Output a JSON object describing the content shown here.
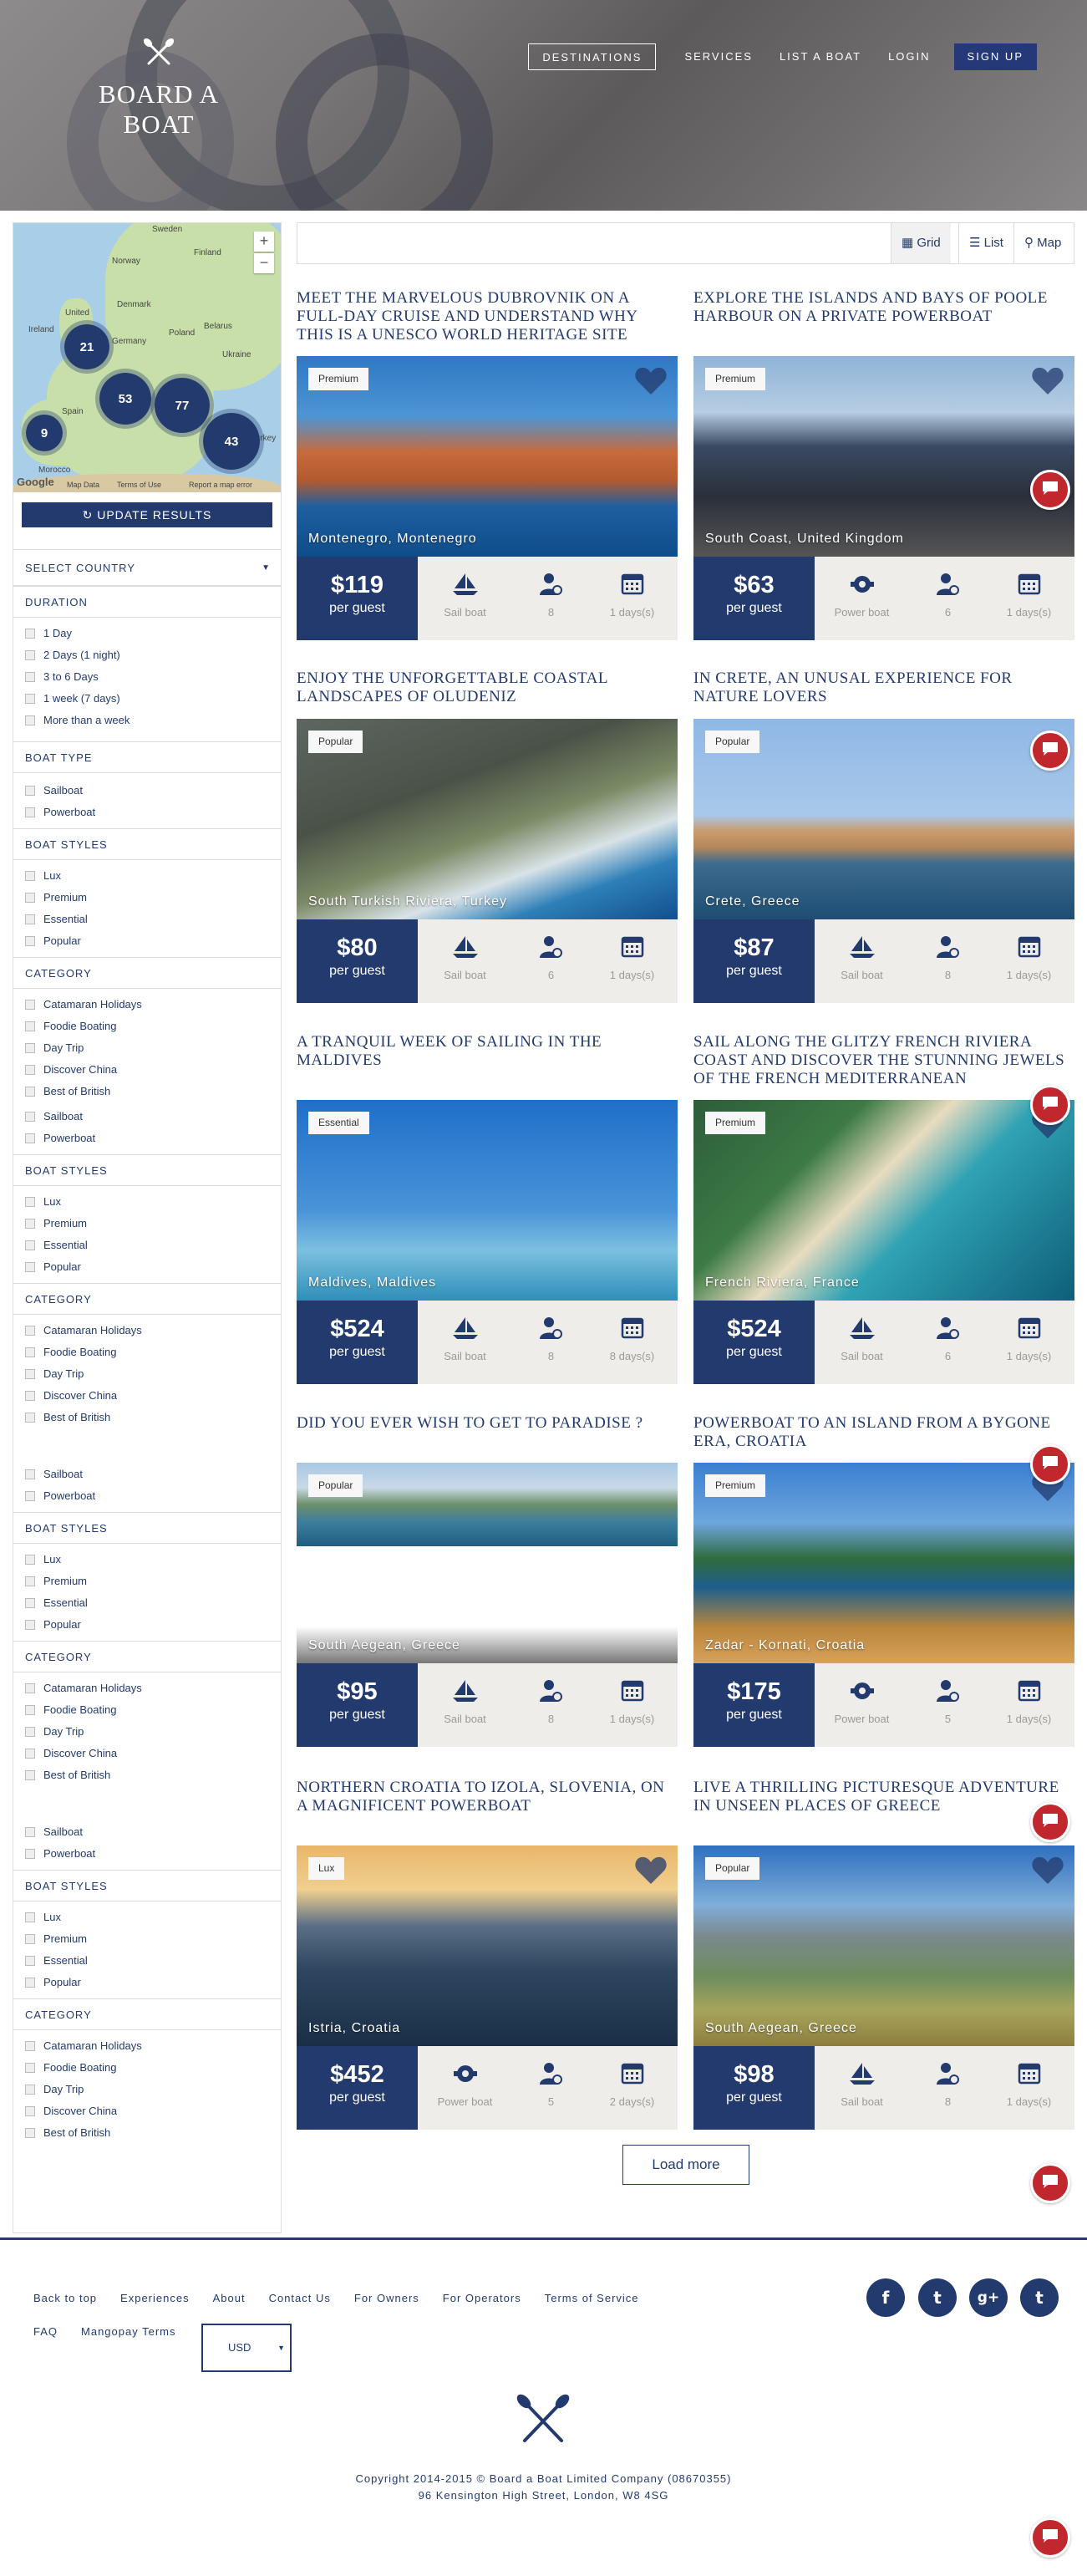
{
  "header": {
    "brand": "BOARD A BOAT",
    "nav": {
      "destinations": "DESTINATIONS",
      "services": "SERVICES",
      "list_boat": "LIST A BOAT",
      "login": "LOGIN",
      "signup": "SIGN UP"
    }
  },
  "map": {
    "clusters": [
      "21",
      "53",
      "77",
      "9",
      "43"
    ],
    "labels": {
      "sweden": "Sweden",
      "finland": "Finland",
      "norway": "Norway",
      "ireland": "Ireland",
      "united": "United",
      "denmark": "Denmark",
      "germany": "Germany",
      "poland": "Poland",
      "belarus": "Belarus",
      "ukraine": "Ukraine",
      "spain": "Spain",
      "turkey": "Turkey",
      "morocco": "Morocco"
    },
    "attribution": {
      "google": "Google",
      "data": "Map Data",
      "terms": "Terms of Use",
      "report": "Report a map error"
    },
    "zoom_in": "+",
    "zoom_out": "−"
  },
  "sidebar": {
    "update_label": "UPDATE RESULTS",
    "select_country": "SELECT COUNTRY",
    "duration_head": "DURATION",
    "durations": [
      "1 Day",
      "2 Days (1 night)",
      "3 to 6 Days",
      "1 week (7 days)",
      "More than a week"
    ],
    "boat_type_head": "BOAT TYPE",
    "boat_types": [
      "Sailboat",
      "Powerboat"
    ],
    "boat_styles_head": "BOAT STYLES",
    "boat_styles": [
      "Lux",
      "Premium",
      "Essential",
      "Popular"
    ],
    "category_head": "CATEGORY",
    "categories": [
      "Catamaran Holidays",
      "Foodie Boating",
      "Day Trip",
      "Discover China",
      "Best of British"
    ]
  },
  "toolbar": {
    "grid": "Grid",
    "list": "List",
    "map": "Map"
  },
  "listings": [
    {
      "title": "MEET THE MARVELOUS DUBROVNIK ON A FULL-DAY CRUISE AND UNDERSTAND WHY THIS IS A UNESCO WORLD HERITAGE SITE",
      "badge": "Premium",
      "location": "Montenegro, Montenegro",
      "price": "$119",
      "per": "per guest",
      "boat": "Sail boat",
      "guests": "8",
      "days": "1 days(s)"
    },
    {
      "title": "EXPLORE THE ISLANDS AND BAYS OF POOLE HARBOUR ON A PRIVATE POWERBOAT",
      "badge": "Premium",
      "location": "South Coast, United Kingdom",
      "price": "$63",
      "per": "per guest",
      "boat": "Power boat",
      "guests": "6",
      "days": "1 days(s)"
    },
    {
      "title": "ENJOY THE UNFORGETTABLE COASTAL LANDSCAPES OF OLUDENIZ",
      "badge": "Popular",
      "location": "South Turkish Riviera, Turkey",
      "price": "$80",
      "per": "per guest",
      "boat": "Sail boat",
      "guests": "6",
      "days": "1 days(s)"
    },
    {
      "title": "IN CRETE, AN UNUSAL EXPERIENCE FOR NATURE LOVERS",
      "badge": "Popular",
      "location": "Crete, Greece",
      "price": "$87",
      "per": "per guest",
      "boat": "Sail boat",
      "guests": "8",
      "days": "1 days(s)"
    },
    {
      "title": "A TRANQUIL WEEK OF SAILING IN THE MALDIVES",
      "badge": "Essential",
      "location": "Maldives, Maldives",
      "price": "$524",
      "per": "per guest",
      "boat": "Sail boat",
      "guests": "8",
      "days": "8 days(s)"
    },
    {
      "title": "SAIL ALONG THE GLITZY FRENCH RIVIERA COAST AND DISCOVER THE STUNNING JEWELS OF THE FRENCH MEDITERRANEAN",
      "badge": "Premium",
      "location": "French Riviera, France",
      "price": "$524",
      "per": "per guest",
      "boat": "Sail boat",
      "guests": "6",
      "days": "1 days(s)"
    },
    {
      "title": "DID YOU EVER WISH TO GET TO PARADISE ?",
      "badge": "Popular",
      "location": "South Aegean, Greece",
      "price": "$95",
      "per": "per guest",
      "boat": "Sail boat",
      "guests": "8",
      "days": "1 days(s)"
    },
    {
      "title": "POWERBOAT TO AN ISLAND FROM A BYGONE ERA, CROATIA",
      "badge": "Premium",
      "location": "Zadar - Kornati, Croatia",
      "price": "$175",
      "per": "per guest",
      "boat": "Power boat",
      "guests": "5",
      "days": "1 days(s)"
    },
    {
      "title": "NORTHERN CROATIA TO IZOLA, SLOVENIA, ON A MAGNIFICENT POWERBOAT",
      "badge": "Lux",
      "location": "Istria, Croatia",
      "price": "$452",
      "per": "per guest",
      "boat": "Power boat",
      "guests": "5",
      "days": "2 days(s)"
    },
    {
      "title": "LIVE A THRILLING PICTURESQUE ADVENTURE IN UNSEEN PLACES OF GREECE",
      "badge": "Popular",
      "location": "South Aegean, Greece",
      "price": "$98",
      "per": "per guest",
      "boat": "Sail boat",
      "guests": "8",
      "days": "1 days(s)"
    }
  ],
  "load_more": "Load more",
  "footer": {
    "links": [
      "Back to top",
      "Experiences",
      "About",
      "Contact Us",
      "For Owners",
      "For Operators",
      "Terms of Service",
      "FAQ",
      "Mangopay Terms"
    ],
    "currency": "USD",
    "social": [
      "f",
      "t",
      "g+",
      "t"
    ],
    "copyright": "Copyright 2014-2015 © Board a Boat Limited Company (08670355)",
    "address": "96 Kensington High Street, London, W8 4SG"
  },
  "colors": {
    "navy": "#233a6e",
    "chat_red": "#c0282d",
    "info_bg": "#eeede9"
  }
}
